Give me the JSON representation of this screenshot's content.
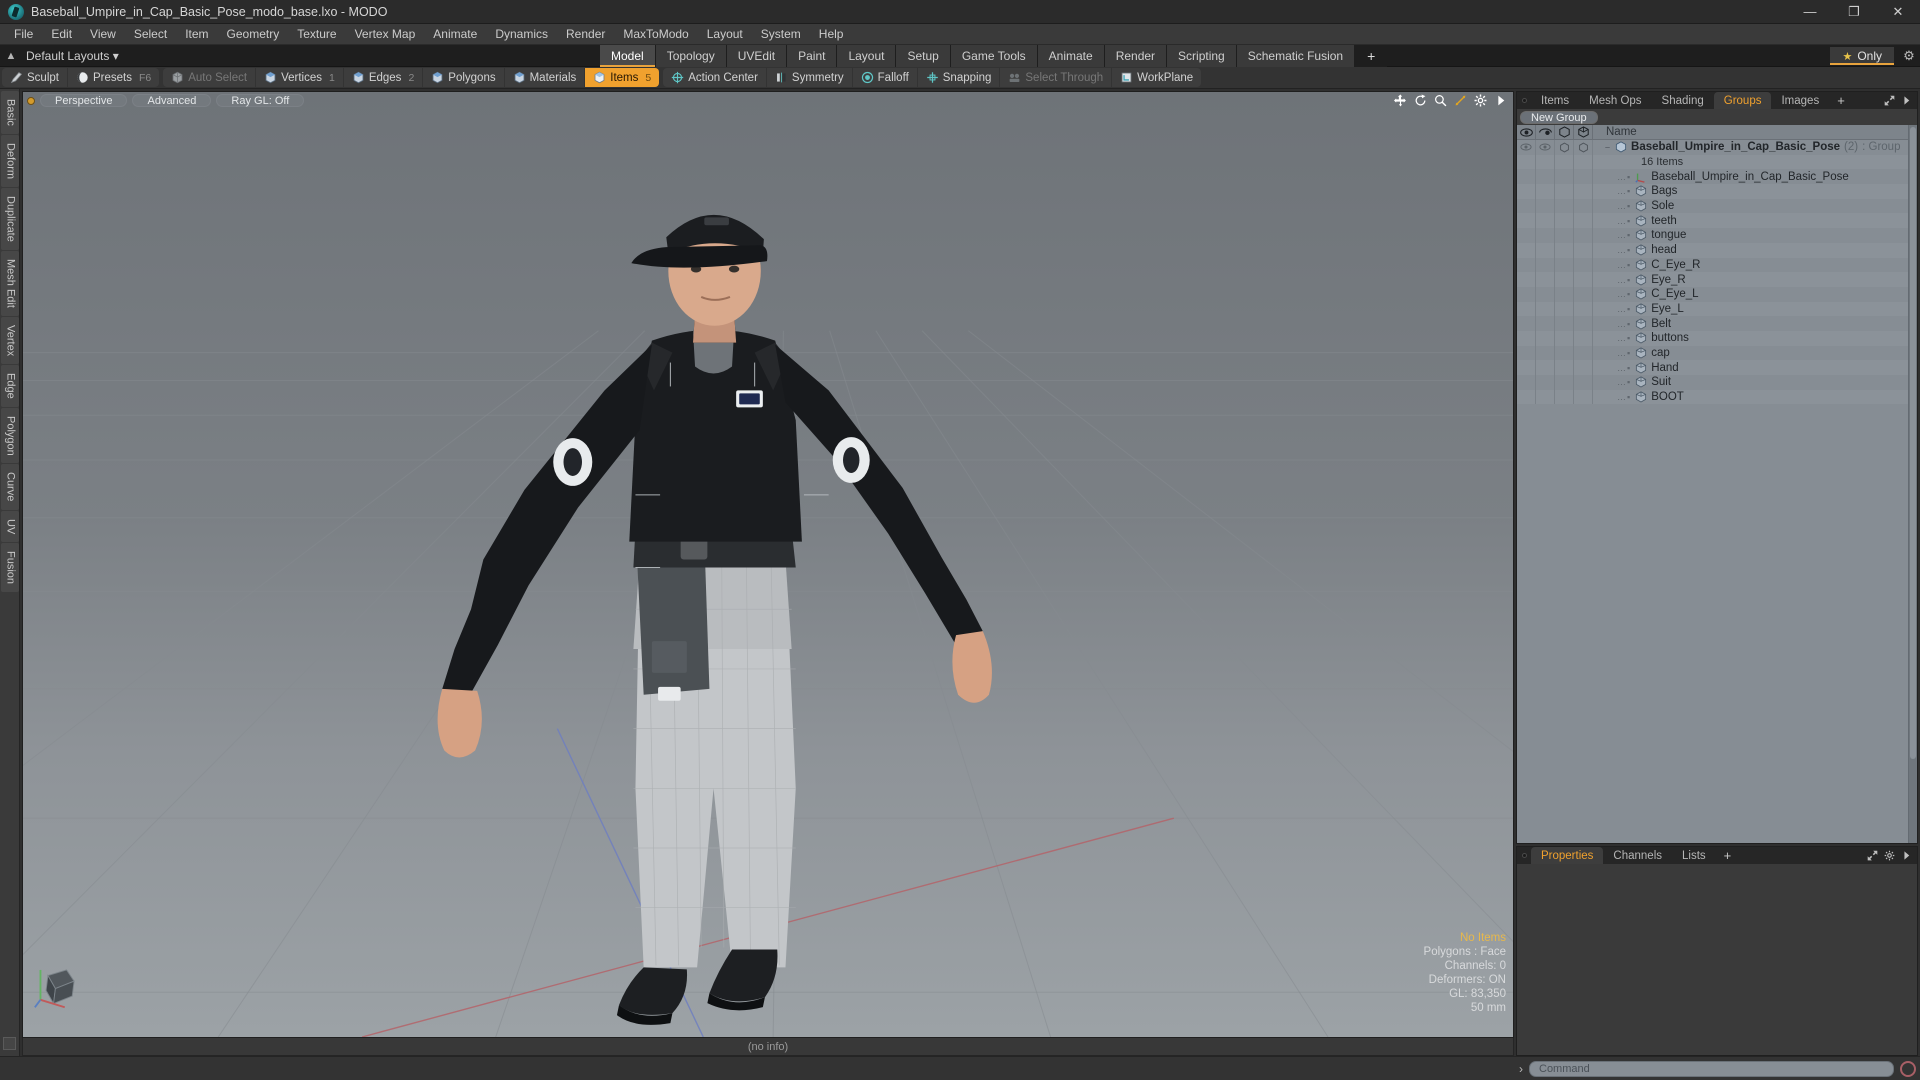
{
  "window": {
    "title": "Baseball_Umpire_in_Cap_Basic_Pose_modo_base.lxo - MODO",
    "logo_icon": "modo-logo-icon",
    "minimize": "—",
    "maximize": "❐",
    "close": "✕"
  },
  "menubar": {
    "items": [
      "File",
      "Edit",
      "View",
      "Select",
      "Item",
      "Geometry",
      "Texture",
      "Vertex Map",
      "Animate",
      "Dynamics",
      "Render",
      "MaxToModo",
      "Layout",
      "System",
      "Help"
    ]
  },
  "layout_row": {
    "home_icon": "home-icon",
    "layouts_label": "Default Layouts ▾",
    "tabs": [
      "Model",
      "Topology",
      "UVEdit",
      "Paint",
      "Layout",
      "Setup",
      "Game Tools",
      "Animate",
      "Render",
      "Scripting",
      "Schematic Fusion"
    ],
    "active_tab": "Model",
    "plus_label": "+",
    "only_label": "Only",
    "star_icon": "star-icon",
    "gear_icon": "gear-icon"
  },
  "toolbar": {
    "groups": [
      {
        "buttons": [
          {
            "label": "Sculpt",
            "icon": "brush-icon",
            "num": "",
            "state": "normal"
          },
          {
            "label": "Presets",
            "icon": "sphere-icon",
            "num": "F6",
            "state": "normal"
          }
        ]
      },
      {
        "buttons": [
          {
            "label": "Auto Select",
            "icon": "cube-grey-icon",
            "num": "",
            "state": "dim"
          },
          {
            "label": "Vertices",
            "icon": "cube-blue-icon",
            "num": "1",
            "state": "normal"
          },
          {
            "label": "Edges",
            "icon": "cube-blue-icon",
            "num": "2",
            "state": "normal"
          },
          {
            "label": "Polygons",
            "icon": "cube-blue-icon",
            "num": "",
            "state": "normal"
          },
          {
            "label": "Materials",
            "icon": "cube-blue-icon",
            "num": "",
            "state": "normal"
          },
          {
            "label": "Items",
            "icon": "cube-white-icon",
            "num": "5",
            "state": "active"
          }
        ]
      },
      {
        "buttons": [
          {
            "label": "Action Center",
            "icon": "crosshair-circle-icon",
            "num": "",
            "state": "normal"
          },
          {
            "label": "Symmetry",
            "icon": "symmetry-icon",
            "num": "",
            "state": "normal"
          },
          {
            "label": "Falloff",
            "icon": "falloff-icon",
            "num": "",
            "state": "normal"
          },
          {
            "label": "Snapping",
            "icon": "snap-icon",
            "num": "",
            "state": "normal"
          },
          {
            "label": "Select Through",
            "icon": "select-through-icon",
            "num": "",
            "state": "dim"
          },
          {
            "label": "WorkPlane",
            "icon": "workplane-icon",
            "num": "",
            "state": "normal"
          }
        ]
      }
    ]
  },
  "left_strip": {
    "tabs": [
      "Basic",
      "Deform",
      "Duplicate",
      "Mesh Edit",
      "Vertex",
      "Edge",
      "Polygon",
      "Curve",
      "UV",
      "Fusion"
    ]
  },
  "viewport": {
    "pills": [
      "Perspective",
      "Advanced",
      "Ray GL: Off"
    ],
    "header_icons": [
      "move-icon",
      "rotate-icon",
      "zoom-icon",
      "fit-icon",
      "gear-icon",
      "chevron-right-icon"
    ],
    "stats": {
      "selection": "No Items",
      "polygons": "Polygons : Face",
      "channels": "Channels: 0",
      "deformers": "Deformers: ON",
      "gl": "GL: 83,350",
      "focal": "50 mm"
    },
    "footer": "(no info)",
    "axis_icon": "axis-gizmo-icon"
  },
  "right_panel": {
    "tabs": [
      "Items",
      "Mesh Ops",
      "Shading",
      "Groups",
      "Images"
    ],
    "active_tab": "Groups",
    "plus_label": "+",
    "expand_icon": "expand-icon",
    "chevron_icon": "chevron-right-icon",
    "new_group_label": "New Group",
    "columns": {
      "eye_icon": "eye-icon",
      "render_icon": "render-visibility-icon",
      "lock_icon": "wireframe-cube-icon",
      "shade_icon": "shaded-cube-icon",
      "name_header": "Name"
    },
    "group": {
      "icon": "group-cube-icon",
      "name": "Baseball_Umpire_in_Cap_Basic_Pose",
      "count": "(2)",
      "type": ": Group",
      "sub_label": "16 Items"
    },
    "items": [
      {
        "name": "Baseball_Umpire_in_Cap_Basic_Pose",
        "icon": "locator-icon"
      },
      {
        "name": "Bags",
        "icon": "mesh-cube-icon"
      },
      {
        "name": "Sole",
        "icon": "mesh-cube-icon"
      },
      {
        "name": "teeth",
        "icon": "mesh-cube-icon"
      },
      {
        "name": "tongue",
        "icon": "mesh-cube-icon"
      },
      {
        "name": "head",
        "icon": "mesh-cube-icon"
      },
      {
        "name": "C_Eye_R",
        "icon": "mesh-cube-icon"
      },
      {
        "name": "Eye_R",
        "icon": "mesh-cube-icon"
      },
      {
        "name": "C_Eye_L",
        "icon": "mesh-cube-icon"
      },
      {
        "name": "Eye_L",
        "icon": "mesh-cube-icon"
      },
      {
        "name": "Belt",
        "icon": "mesh-cube-icon"
      },
      {
        "name": "buttons",
        "icon": "mesh-cube-icon"
      },
      {
        "name": "cap",
        "icon": "mesh-cube-icon"
      },
      {
        "name": "Hand",
        "icon": "mesh-cube-icon"
      },
      {
        "name": "Suit",
        "icon": "mesh-cube-icon"
      },
      {
        "name": "BOOT",
        "icon": "mesh-cube-icon"
      }
    ]
  },
  "properties_panel": {
    "tabs": [
      "Properties",
      "Channels",
      "Lists"
    ],
    "active_tab": "Properties",
    "plus_label": "+",
    "expand_icon": "expand-icon",
    "gear_icon": "gear-icon",
    "chevron_icon": "chevron-right-icon"
  },
  "command_bar": {
    "prompt": "›",
    "placeholder": "Command",
    "value": "",
    "record_icon": "record-icon"
  },
  "colors": {
    "accent": "#f0a12e",
    "panel_bg": "#2f2f2f",
    "tree_bg": "#868d94",
    "titlebar_bg": "#2b2b2b"
  }
}
